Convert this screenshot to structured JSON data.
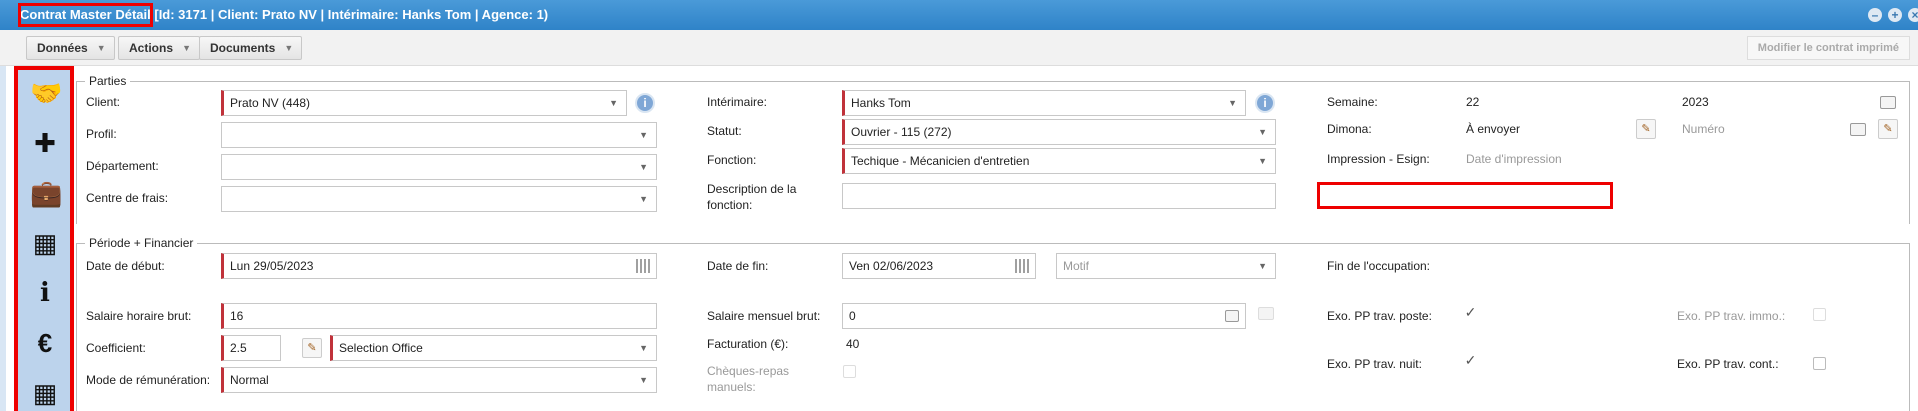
{
  "window": {
    "title": "Contrat Master Détail [Id: 3171 | Client: Prato NV | Intérimaire: Hanks Tom | Agence: 1)",
    "btn_minimize": "–",
    "btn_maximize": "+",
    "btn_close": "×"
  },
  "toolbar": {
    "donnees": "Données",
    "actions": "Actions",
    "documents": "Documents",
    "modifier": "Modifier le contrat imprimé",
    "caret": "▼"
  },
  "sidebar": {
    "icons": [
      "handshake-icon",
      "calendar-plus-icon",
      "briefcase-icon",
      "calendar-icon",
      "info-icon",
      "euro-icon",
      "calculator-icon"
    ],
    "glyphs": [
      "🤝",
      "✚",
      "💼",
      "▦",
      "i",
      "€",
      "▦"
    ]
  },
  "parties": {
    "legend": "Parties",
    "client_label": "Client:",
    "client_value": "Prato NV (448)",
    "profil_label": "Profil:",
    "departement_label": "Département:",
    "centre_label": "Centre de frais:",
    "interimaire_label": "Intérimaire:",
    "interimaire_value": "Hanks Tom",
    "statut_label": "Statut:",
    "statut_value": "Ouvrier - 115 (272)",
    "fonction_label": "Fonction:",
    "fonction_value": "Techique - Mécanicien d'entretien",
    "description_label": "Description de la fonction:",
    "semaine_label": "Semaine:",
    "semaine_value": "22",
    "year_value": "2023",
    "dimona_label": "Dimona:",
    "dimona_value": "À envoyer",
    "numero_placeholder": "Numéro",
    "impression_label": "Impression - Esign:",
    "impression_value": "Date d'impression",
    "info": "i"
  },
  "periode": {
    "legend": "Période + Financier",
    "debut_label": "Date de début:",
    "debut_value": "Lun 29/05/2023",
    "fin_label": "Date de fin:",
    "fin_value": "Ven 02/06/2023",
    "motif_placeholder": "Motif",
    "fin_occupation_label": "Fin de l'occupation:",
    "salaire_horaire_label": "Salaire horaire brut:",
    "salaire_horaire_value": "16",
    "salaire_mensuel_label": "Salaire mensuel brut:",
    "salaire_mensuel_value": "0",
    "exo_poste_label": "Exo. PP trav. poste:",
    "exo_immo_label": "Exo. PP trav. immo.:",
    "coefficient_label": "Coefficient:",
    "coefficient_value": "2.5",
    "coefficient_select": "Selection Office",
    "facturation_label": "Facturation (€):",
    "facturation_value": "40",
    "mode_label": "Mode de rémunération:",
    "mode_value": "Normal",
    "cheques_label": "Chèques-repas manuels:",
    "exo_nuit_label": "Exo. PP trav. nuit:",
    "exo_cont_label": "Exo. PP trav. cont.:",
    "check": "✓"
  }
}
